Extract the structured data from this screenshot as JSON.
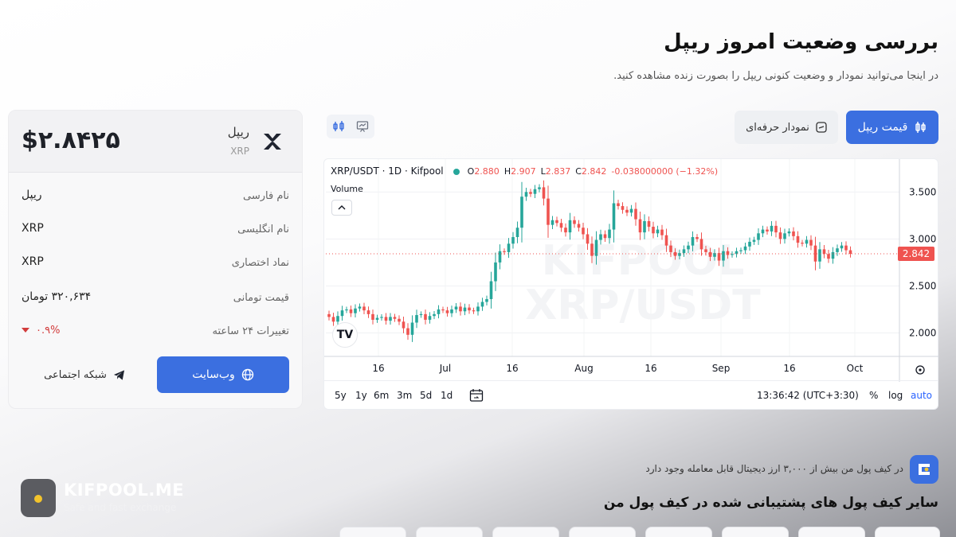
{
  "header": {
    "title": "بررسی وضعیت امروز ریپل",
    "subtitle": "در اینجا می‌توانید نمودار و وضعیت کنونی ریپل را بصورت زنده مشاهده کنید."
  },
  "coin_card": {
    "price": "$۲.۸۴۲۵",
    "name": "ریپل",
    "symbol": "XRP",
    "logo_icon": "xrp-logo-icon",
    "rows": [
      {
        "label": "نام فارسی",
        "value": "ریپل"
      },
      {
        "label": "نام انگلیسی",
        "value": "XRP"
      },
      {
        "label": "نماد اختصاری",
        "value": "XRP"
      },
      {
        "label": "قیمت تومانی",
        "value": "۳۲۰,۶۳۴ تومان"
      },
      {
        "label": "تغییرات ۲۴ ساعته",
        "value": "۰.۹%"
      }
    ],
    "website_button": "وب‌سایت",
    "social_button": "شبکه اجتماعی"
  },
  "tabs": {
    "price_tab": "قیمت ریپل",
    "pro_chart_tab": "نمودار حرفه‌ای"
  },
  "chart": {
    "symbol": "XRP/USDT · 1D · Kifpool",
    "o_label": "O",
    "o_value": "2.880",
    "h_label": "H",
    "h_value": "2.907",
    "l_label": "L",
    "l_value": "2.837",
    "c_label": "C",
    "c_value": "2.842",
    "change": "-0.038000000 (−1.32%)",
    "volume_label": "Volume",
    "watermark_line1": "KIFPOOL",
    "watermark_line2": "XRP/USDT",
    "tv_logo": "TV",
    "current_price": "2.842",
    "timeframes": [
      "5y",
      "1y",
      "6m",
      "3m",
      "5d",
      "1d"
    ],
    "time": "13:36:42 (UTC+3:30)",
    "percent_option": "%",
    "log_option": "log",
    "auto_option": "auto"
  },
  "chart_data": {
    "type": "candlestick",
    "y_ticks": [
      "3.500",
      "3.000",
      "2.500",
      "2.000"
    ],
    "x_ticks": [
      "16",
      "Jul",
      "16",
      "Aug",
      "16",
      "Sep",
      "16",
      "Oct"
    ],
    "ylim": [
      1.75,
      3.85
    ],
    "last_close": 2.842,
    "up_color": "#26a69a",
    "down_color": "#ef5350",
    "closes": [
      2.17,
      2.12,
      2.18,
      2.24,
      2.25,
      2.21,
      2.26,
      2.28,
      2.24,
      2.2,
      2.14,
      2.16,
      2.17,
      2.13,
      2.17,
      2.15,
      2.12,
      2.05,
      1.98,
      2.11,
      2.19,
      2.2,
      2.14,
      2.18,
      2.2,
      2.25,
      2.24,
      2.21,
      2.25,
      2.28,
      2.23,
      2.27,
      2.24,
      2.23,
      2.28,
      2.33,
      2.36,
      2.55,
      2.75,
      2.87,
      2.86,
      2.95,
      3.02,
      3.12,
      3.45,
      3.5,
      3.48,
      3.53,
      3.55,
      3.43,
      3.15,
      3.2,
      3.17,
      3.12,
      3.07,
      3.2,
      3.16,
      3.12,
      3.05,
      2.95,
      2.82,
      2.99,
      3.05,
      3.01,
      3.1,
      3.38,
      3.35,
      3.31,
      3.28,
      3.32,
      3.21,
      3.07,
      3.19,
      3.13,
      3.06,
      3.1,
      3.04,
      2.93,
      2.86,
      2.82,
      2.85,
      2.89,
      2.93,
      3.02,
      3.0,
      2.89,
      2.86,
      2.81,
      2.85,
      2.77,
      2.87,
      2.83,
      2.84,
      2.87,
      2.88,
      2.92,
      2.97,
      2.99,
      3.06,
      3.1,
      3.08,
      3.14,
      3.07,
      3.0,
      3.06,
      3.08,
      3.03,
      2.96,
      2.95,
      2.99,
      2.93,
      2.76,
      2.89,
      2.84,
      2.79,
      2.86,
      2.9,
      2.93,
      2.88,
      2.842
    ]
  },
  "promo": {
    "text": "در کیف پول من بیش از ۳,۰۰۰ ارز دیجیتال قابل معامله وجود دارد",
    "section_title": "سایر کیف پول های پشتیبانی شده در کیف پول من"
  },
  "brand": {
    "name": "KIFPOOL.ME",
    "tagline": "Safe and fast exchange"
  }
}
